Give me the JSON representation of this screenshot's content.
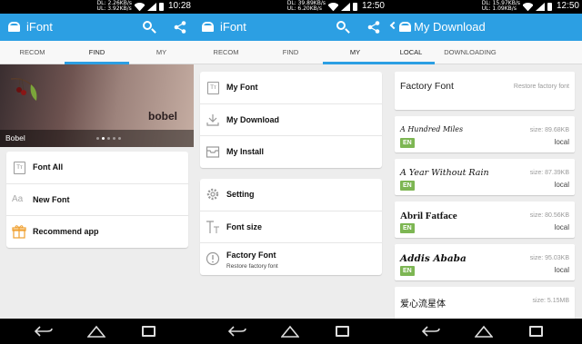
{
  "colors": {
    "accent": "#2c9fe3",
    "badge_green": "#7db653"
  },
  "panel1": {
    "status": {
      "dl": "DL: 2.26KB/s",
      "ul": "UL: 3.92KB/s",
      "time": "10:28"
    },
    "app_title": "iFont",
    "tabs": [
      "RECOM",
      "FIND",
      "MY"
    ],
    "active_tab": "FIND",
    "banner": {
      "logo_text": "bobel",
      "name": "Bobel"
    },
    "menu": [
      {
        "label": "Font All",
        "icon": "font-box-icon"
      },
      {
        "label": "New Font",
        "icon": "aa-icon"
      },
      {
        "label": "Recommend app",
        "icon": "gift-icon"
      }
    ]
  },
  "panel2": {
    "status": {
      "dl": "DL: 39.89KB/s",
      "ul": "UL: 6.20KB/s",
      "time": "12:50"
    },
    "app_title": "iFont",
    "tabs": [
      "RECOM",
      "FIND",
      "MY"
    ],
    "active_tab": "MY",
    "group1": [
      {
        "label": "My Font",
        "icon": "font-box-icon"
      },
      {
        "label": "My Download",
        "icon": "download-icon"
      },
      {
        "label": "My Install",
        "icon": "install-box-icon"
      }
    ],
    "group2": [
      {
        "label": "Setting",
        "icon": "gear-icon"
      },
      {
        "label": "Font size",
        "icon": "font-size-icon"
      },
      {
        "label": "Factory Font",
        "sub": "Restore factory font",
        "icon": "info-icon"
      }
    ]
  },
  "panel3": {
    "status": {
      "dl": "DL: 15.97KB/s",
      "ul": "UL: 1.09KB/s",
      "time": "12:50"
    },
    "app_title": "My Download",
    "tabs": [
      "LOCAL",
      "DOWNLOADING"
    ],
    "active_tab": "LOCAL",
    "factory": {
      "title": "Factory Font",
      "action": "Restore factory font"
    },
    "fonts": [
      {
        "name": "A Hundred Miles",
        "size": "size: 89.68KB",
        "badge": "EN",
        "location": "local"
      },
      {
        "name": "A Year Without Rain",
        "size": "size: 87.39KB",
        "badge": "EN",
        "location": "local"
      },
      {
        "name": "Abril Fatface",
        "size": "size: 80.56KB",
        "badge": "EN",
        "location": "local"
      },
      {
        "name": "Addis Ababa",
        "size": "size: 95.03KB",
        "badge": "EN",
        "location": "local"
      },
      {
        "name": "爱心流星体",
        "size": "size: 5.15MB",
        "badge": "",
        "location": ""
      }
    ]
  }
}
